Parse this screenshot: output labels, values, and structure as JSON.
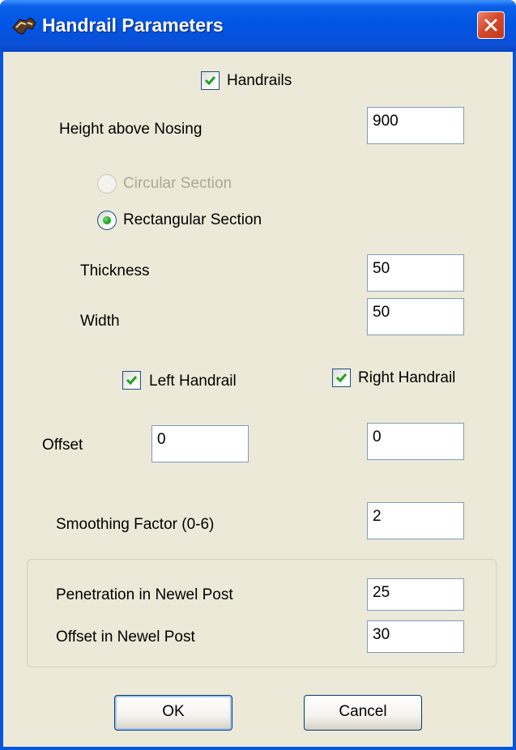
{
  "window": {
    "title": "Handrail Parameters",
    "icon": "handrail-app-icon",
    "close_icon": "close-icon"
  },
  "handrails": {
    "label": "Handrails",
    "checked": true
  },
  "height_above_nosing": {
    "label": "Height above Nosing",
    "value": "900"
  },
  "section": {
    "circular": {
      "label": "Circular Section",
      "enabled": false,
      "selected": false
    },
    "rectangular": {
      "label": "Rectangular Section",
      "enabled": true,
      "selected": true
    }
  },
  "thickness": {
    "label": "Thickness",
    "value": "50"
  },
  "width": {
    "label": "Width",
    "value": "50"
  },
  "left_handrail": {
    "label": "Left Handrail",
    "checked": true
  },
  "right_handrail": {
    "label": "Right Handrail",
    "checked": true
  },
  "offset": {
    "label": "Offset",
    "left_value": "0",
    "right_value": "0"
  },
  "smoothing": {
    "label": "Smoothing Factor (0-6)",
    "value": "2"
  },
  "newel": {
    "penetration": {
      "label": "Penetration in Newel Post",
      "value": "25"
    },
    "offset": {
      "label": "Offset in Newel Post",
      "value": "30"
    }
  },
  "buttons": {
    "ok": "OK",
    "cancel": "Cancel"
  },
  "colors": {
    "titlebar": "#0054e3",
    "dialog_bg": "#ece9d8",
    "check_green": "#21a121",
    "close_red": "#d6492a"
  }
}
